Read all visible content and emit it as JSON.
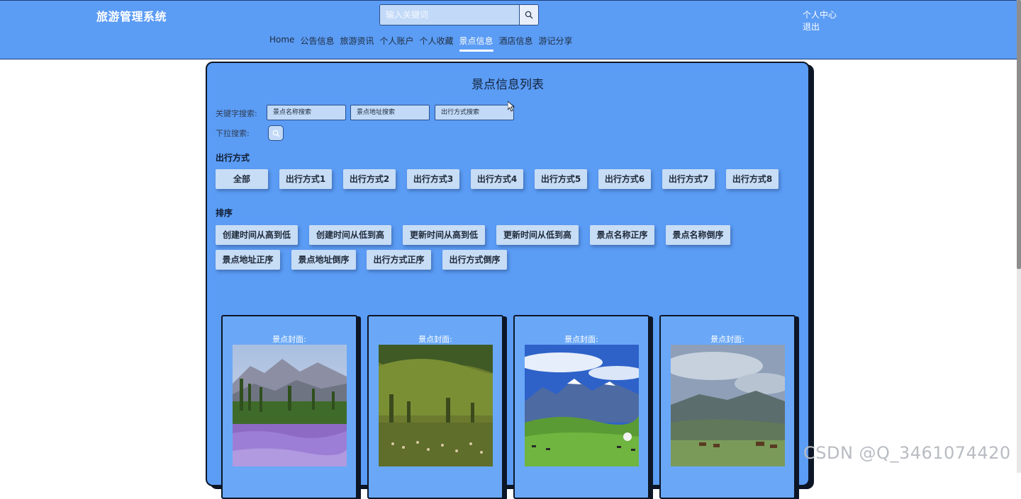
{
  "header": {
    "brand": "旅游管理系统",
    "search_placeholder": "输入关键词",
    "user_center": "个人中心",
    "logout": "退出",
    "nav": [
      "Home",
      "公告信息",
      "旅游资讯",
      "个人账户",
      "个人收藏",
      "景点信息",
      "酒店信息",
      "游记分享"
    ],
    "active_nav": "景点信息"
  },
  "panel": {
    "title": "景点信息列表",
    "keyword_label": "关键字搜索:",
    "dropdown_label": "下拉搜索:",
    "keyword_inputs": [
      "景点名称搜索",
      "景点地址搜索",
      "出行方式搜索"
    ],
    "travel_section": "出行方式",
    "travel_options": [
      "全部",
      "出行方式1",
      "出行方式2",
      "出行方式3",
      "出行方式4",
      "出行方式5",
      "出行方式6",
      "出行方式7",
      "出行方式8"
    ],
    "sort_section": "排序",
    "sort_options": [
      "创建时间从高到低",
      "创建时间从低到高",
      "更新时间从高到低",
      "更新时间从低到高",
      "景点名称正序",
      "景点名称倒序",
      "景点地址正序",
      "景点地址倒序",
      "出行方式正序",
      "出行方式倒序"
    ]
  },
  "cards": [
    {
      "label": "景点封面:",
      "image": "lavender-field-mountains"
    },
    {
      "label": "景点封面:",
      "image": "green-valley-grazing"
    },
    {
      "label": "景点封面:",
      "image": "snow-mountain-grassland-yurt"
    },
    {
      "label": "景点封面:",
      "image": "cloudy-mountain-horses"
    }
  ],
  "watermark": "CSDN @Q_3461074420",
  "colors": {
    "primary": "#5b9cf5",
    "chip": "#c7dcf5",
    "border": "#0d1626"
  }
}
